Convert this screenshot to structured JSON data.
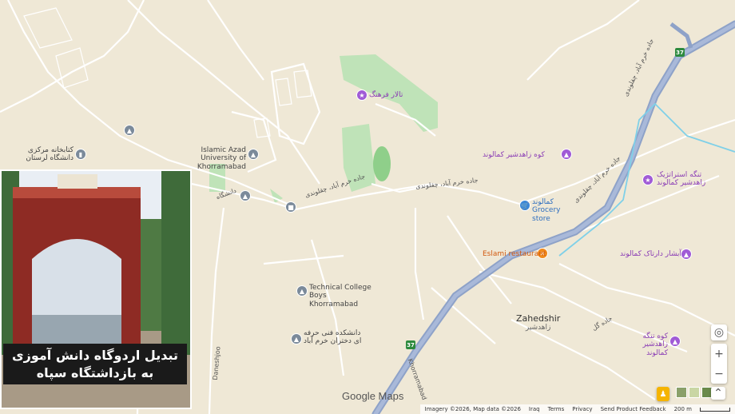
{
  "map": {
    "pois": [
      {
        "id": "talar",
        "label": "تالار فرهنگ",
        "icon": "landmark-icon"
      },
      {
        "id": "azad",
        "label": "Islamic Azad University of Khorramabad",
        "icon": "school-icon"
      },
      {
        "id": "library",
        "label": "کتابخانه مرکزی دانشگاه لرستان",
        "icon": "library-icon"
      },
      {
        "id": "kuh-zahedshir",
        "label": "کوه زاهدشیر کمالوند",
        "icon": "mountain-icon"
      },
      {
        "id": "grocery",
        "label": "کمالوند Grocery store",
        "icon": "grocery-icon"
      },
      {
        "id": "tange",
        "label": "تنگه استراتژیک زاهدشیر کمالوند",
        "icon": "landmark-icon"
      },
      {
        "id": "eslami",
        "label": "Eslami restaurant",
        "icon": "restaurant-icon"
      },
      {
        "id": "abshar",
        "label": "آبشار دارتاک کمالوند",
        "icon": "waterfall-icon"
      },
      {
        "id": "technical",
        "label": "Technical College Boys Khorramabad",
        "icon": "school-icon"
      },
      {
        "id": "fani",
        "label": "دانشکده فنی حرفه ای دختران خرم آباد",
        "icon": "school-icon"
      },
      {
        "id": "kuh-tange",
        "label": "کوه تنگه زاهدشیر کمالوند",
        "icon": "mountain-icon"
      }
    ],
    "places": [
      {
        "id": "zahedshir",
        "label": "Zahedshir",
        "sub": "زاهدشیر"
      }
    ],
    "roads": [
      {
        "id": "jadeh1",
        "label": "جاده خرم آباد، چقلوندی"
      },
      {
        "id": "jadeh2",
        "label": "جاده خرم آباد، چقلوندی"
      },
      {
        "id": "jadeh3",
        "label": "جاده خرم آباد، چقلوندی"
      },
      {
        "id": "jadeh4",
        "label": "جاده خرم آباد، چقلوندی"
      },
      {
        "id": "daneshjoo",
        "label": "Daneshjoo"
      },
      {
        "id": "khorramabad",
        "label": "Khorramabad"
      },
      {
        "id": "daneshgah",
        "label": "دانشگاه"
      },
      {
        "id": "jadeh-golf",
        "label": "جاده گل"
      }
    ],
    "shields": [
      {
        "id": "r37a",
        "label": "37"
      },
      {
        "id": "r37b",
        "label": "37"
      }
    ]
  },
  "overlay": {
    "caption": "تبدیل اردوگاه دانش آموزی به بازداشتگاه سپاه"
  },
  "branding": {
    "logo": "Google Maps"
  },
  "attribution": {
    "imagery": "Imagery ©2026, Map data ©2026",
    "country": "Iraq",
    "terms": "Terms",
    "privacy": "Privacy",
    "feedback": "Send Product Feedback",
    "scale": "200 m"
  },
  "controls": {
    "zoom_in": "+",
    "zoom_out": "−",
    "locate": "◎",
    "expand": "⌃"
  }
}
